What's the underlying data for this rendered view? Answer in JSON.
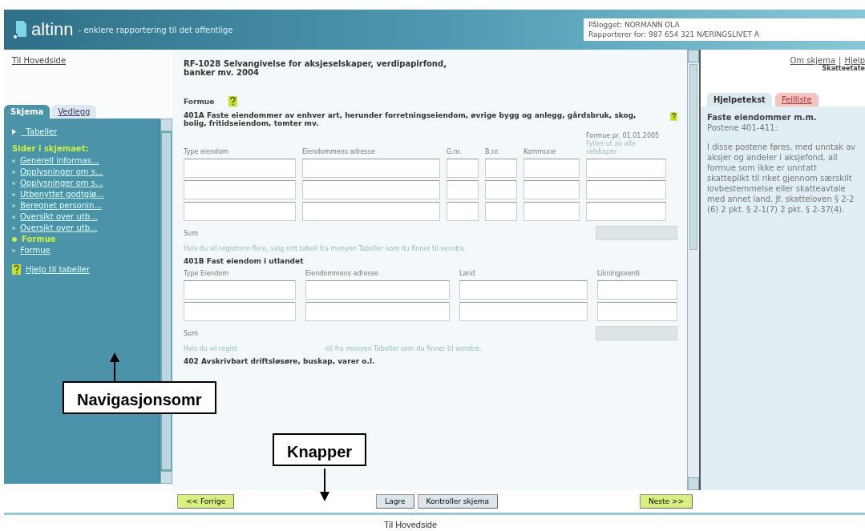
{
  "header": {
    "logo": "altinn",
    "tagline": "- enklere rapportering til det offentlige",
    "login": [
      "Pålogget: NORMANN OLA",
      "Rapporterer for: 987 654 321 NÆRINGSLIVET A"
    ]
  },
  "home_link": "Til Hovedside",
  "left_tabs": [
    {
      "label": "Skjema",
      "selected": true
    },
    {
      "label": "Vedlegg",
      "selected": false
    }
  ],
  "nav": {
    "tables_link": "Tabeller",
    "heading": "Sider i skjemaet:",
    "items": [
      {
        "label": "Generell informas...",
        "selected": false
      },
      {
        "label": "Opplysninger om s...",
        "selected": false
      },
      {
        "label": "Opplysninger om s...",
        "selected": false
      },
      {
        "label": "Utbenyttet godtgjø...",
        "selected": false
      },
      {
        "label": "Beregnet personin...",
        "selected": false
      },
      {
        "label": "Oversikt over utb...",
        "selected": false
      },
      {
        "label": "Oversikt over utb...",
        "selected": false
      },
      {
        "label": "Formue",
        "selected": true
      },
      {
        "label": "Formue",
        "selected": false
      }
    ],
    "help_link": "Hjelp til tabeller"
  },
  "form": {
    "title": "RF-1028 Selvangivelse for aksjeselskaper, verdipapirfond, banker mv. 2004",
    "section": "Formue",
    "tables": [
      {
        "heading": "401A Faste eiendommer av enhver art, herunder forretningseiendom, øvrige bygg og anlegg, gårdsbruk, skog, bolig, fritidseiendom, tomter mv.",
        "help": true,
        "kind": "wide",
        "columns": [
          {
            "label": "Type eiendom"
          },
          {
            "label": "Eiendommens adresse"
          },
          {
            "label": "G.nr."
          },
          {
            "label": "B.nr."
          },
          {
            "label": "Kommune"
          },
          {
            "label": "Formue pr. 01.01.2005",
            "note": "Fylles ut av alle selskaper"
          }
        ],
        "rows": [
          [
            {
              "disabled": false
            },
            {
              "disabled": false
            },
            {
              "disabled": false
            },
            {
              "disabled": false
            },
            {
              "disabled": false
            },
            {
              "disabled": false
            }
          ],
          [
            {
              "disabled": false
            },
            {
              "disabled": false
            },
            {
              "disabled": false
            },
            {
              "disabled": false
            },
            {
              "disabled": false
            },
            {
              "disabled": false
            }
          ],
          [
            {
              "disabled": false
            },
            {
              "disabled": false
            },
            {
              "disabled": false
            },
            {
              "disabled": false
            },
            {
              "disabled": false
            },
            {
              "disabled": false
            }
          ]
        ],
        "sum_label": "Sum",
        "sum_field": {
          "disabled": true
        },
        "note": [
          "Hvis du vil registrere flere, velg rett tabell fra menyen Tabeller som du finner til venstre."
        ]
      },
      {
        "heading": "401B Fast eiendom i utlandet",
        "help": false,
        "kind": "foreign",
        "columns": [
          {
            "label": "Type Eiendom"
          },
          {
            "label": "Eiendommens adresse"
          },
          {
            "label": "Land"
          },
          {
            "label": "Likningsverdi"
          }
        ],
        "rows": [
          [
            {
              "disabled": false
            },
            {
              "disabled": false
            },
            {
              "disabled": false
            },
            {
              "disabled": false
            }
          ],
          [
            {
              "disabled": false
            },
            {
              "disabled": false
            },
            {
              "disabled": false
            },
            {
              "disabled": false
            }
          ]
        ],
        "sum_label": "Sum",
        "sum_field": {
          "disabled": true
        },
        "note": [
          "Hvis du vil regist",
          "ell fra menyen Tabeller som du finner til venstre."
        ]
      }
    ],
    "next_heading": "402 Avskrivbart driftsløsøre, buskap, varer o.l."
  },
  "buttons": [
    {
      "label": "<< Forrige",
      "kind": "nav"
    },
    {
      "label": "Lagre",
      "kind": "plain"
    },
    {
      "label": "Kontroller skjema",
      "kind": "plain"
    },
    {
      "label": "Neste >>",
      "kind": "nav"
    }
  ],
  "right": {
    "links": [
      "Om skjema",
      "|",
      "Hjelp"
    ],
    "agency": "Skatteetate",
    "tabs": [
      {
        "label": "Hjelpetekst",
        "selected": true
      },
      {
        "label": "Feilliste",
        "selected": false
      }
    ],
    "help_title": "Faste eiendommer m.m.",
    "help_sub": "Postene 401-411:",
    "help_text": "I disse postene føres, med unntak av aksjer og andeler i aksjefond, all formue som ikke er unntatt skatteplikt til riket gjennom særskilt lovbestemmelse eller skatteavtale med annet land. Jf. skatteloven § 2-2 (6) 2 pkt. § 2-1(7) 2 pkt. § 2-37(4)."
  },
  "bottom_link": "Til Hovedside",
  "annotations": [
    {
      "text": "Navigasjonsomr",
      "kind": "up"
    },
    {
      "text": "Knapper",
      "kind": "down"
    }
  ]
}
